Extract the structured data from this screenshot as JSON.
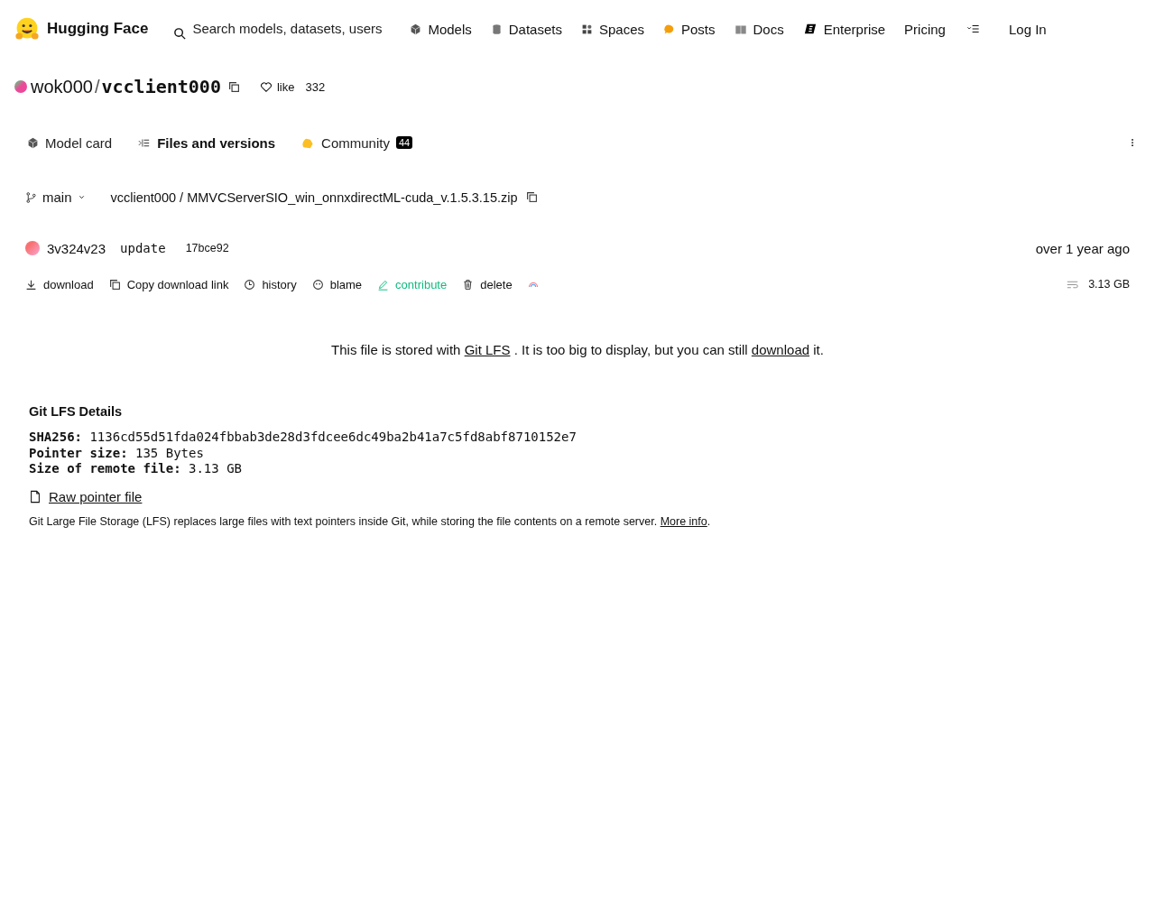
{
  "header": {
    "brand": "Hugging Face",
    "search": {
      "placeholder": "Search models, datasets, users"
    },
    "nav": [
      {
        "label": "Models"
      },
      {
        "label": "Datasets"
      },
      {
        "label": "Spaces"
      },
      {
        "label": "Posts"
      },
      {
        "label": "Docs"
      },
      {
        "label": "Enterprise"
      },
      {
        "label": "Pricing"
      }
    ],
    "login": "Log In"
  },
  "repo": {
    "owner": "wok000",
    "separator": "/",
    "name": "vcclient000",
    "like": "like",
    "likes": "332"
  },
  "tabs": [
    {
      "label": "Model card",
      "selected": false
    },
    {
      "label": "Files and versions",
      "selected": true
    },
    {
      "label": "Community",
      "selected": false,
      "badge": "44"
    }
  ],
  "file": {
    "branch": "main",
    "path": "vcclient000 / MMVCServerSIO_win_onnxdirectML-cuda_v.1.5.3.15.zip",
    "author": "3v324v23",
    "message": "update",
    "commit": "17bce92",
    "time": "over 1 year ago",
    "actions": [
      {
        "label": "download",
        "kind": "plain"
      },
      {
        "label": "Copy download link",
        "kind": "plain"
      },
      {
        "label": "history",
        "kind": "plain"
      },
      {
        "label": "blame",
        "kind": "plain"
      },
      {
        "label": "contribute",
        "kind": "accent"
      },
      {
        "label": "delete",
        "kind": "plain"
      }
    ],
    "size": "3.13 GB"
  },
  "notice": [
    {
      "kind": "text",
      "text": "This file is stored with "
    },
    {
      "kind": "link",
      "text": "Git LFS"
    },
    {
      "kind": "text",
      "text": " . It is too big to display, but you can still "
    },
    {
      "kind": "link",
      "text": "download"
    },
    {
      "kind": "text",
      "text": " it."
    }
  ],
  "lfs": {
    "title": "Git LFS Details",
    "rows": [
      {
        "label": "SHA256:",
        "value": "1136cd55d51fda024fbbab3de28d3fdcee6dc49ba2b41a7c5fd8abf8710152e7"
      },
      {
        "label": "Pointer size:",
        "value": "135 Bytes"
      },
      {
        "label": "Size of remote file:",
        "value": "3.13 GB"
      }
    ],
    "raw_link": "Raw pointer file",
    "note": [
      {
        "kind": "text",
        "text": "Git Large File Storage (LFS) replaces large files with text pointers inside Git, while storing the file contents on a remote server. "
      },
      {
        "kind": "link",
        "text": "More info"
      },
      {
        "kind": "text",
        "text": "."
      }
    ]
  }
}
